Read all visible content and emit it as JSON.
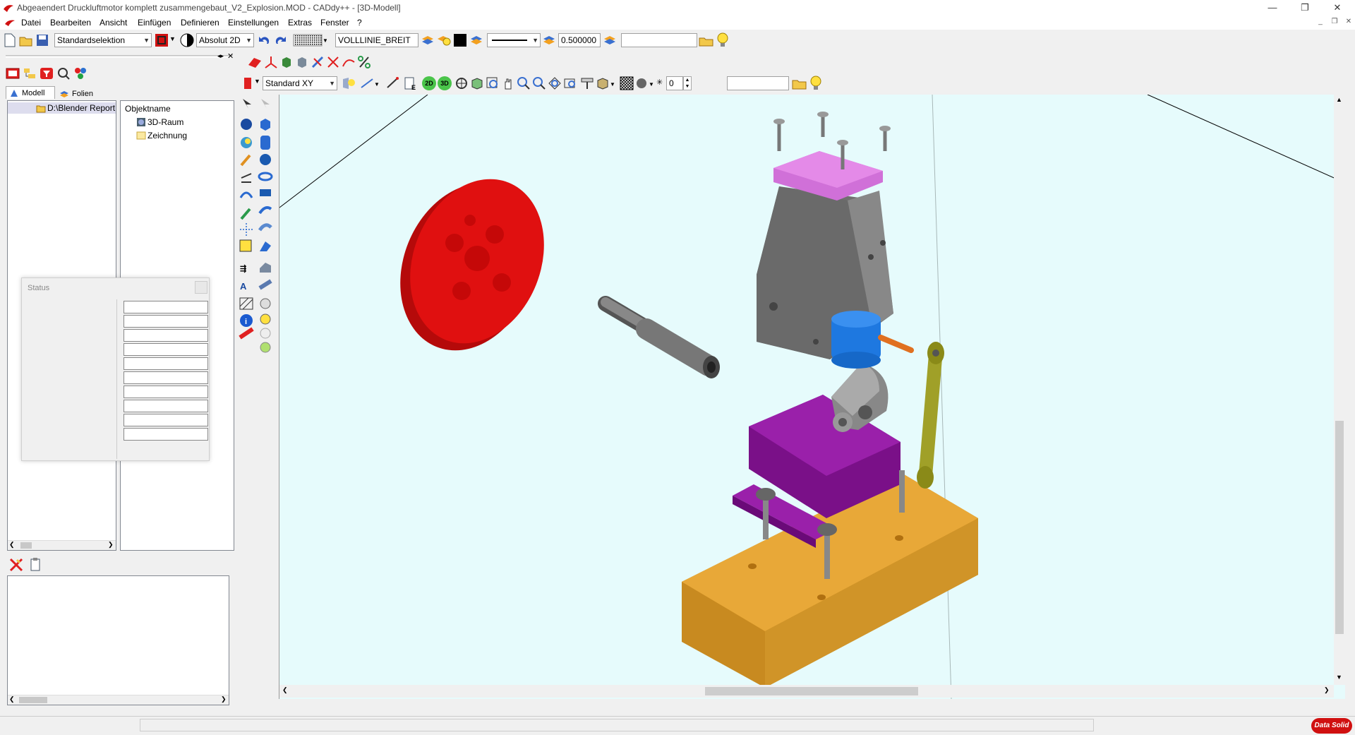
{
  "app": {
    "title": "Abgeaendert Druckluftmotor komplett zusammengebaut_V2_Explosion.MOD  -  CADdy++ - [3D-Modell]",
    "logo_text": "Data Solid"
  },
  "menu": [
    "Datei",
    "Bearbeiten",
    "Ansicht",
    "Einfügen",
    "Definieren",
    "Einstellungen",
    "Extras",
    "Fenster",
    "?"
  ],
  "toolbar": {
    "selection_mode": "Standardselektion",
    "coordinate_mode": "Absolut 2D",
    "line_type": "VOLLLINIE_BREIT",
    "line_width": "0.500000",
    "layer_search": ""
  },
  "view_toolbar": {
    "view_preset": "Standard XY",
    "btn_2d": "2D",
    "btn_3d": "3D",
    "spin_value": "0",
    "filter_value": ""
  },
  "left_panel": {
    "tabs": [
      "Modell",
      "Folien"
    ],
    "tree_root": "D:\\Blender Report",
    "object_header": "Objektname",
    "objects": [
      "3D-Raum",
      "Zeichnung"
    ]
  },
  "status_window": {
    "title": "Status",
    "field_count": 10
  },
  "colors": {
    "viewport_bg": "#e6fbfc",
    "flywheel": "#e01010",
    "base": "#e0a030",
    "bracket": "#8a189a",
    "plate": "#e48ae8",
    "cylinder": "#707070",
    "piston": "#1e78e0",
    "rod": "#9a9a20"
  }
}
